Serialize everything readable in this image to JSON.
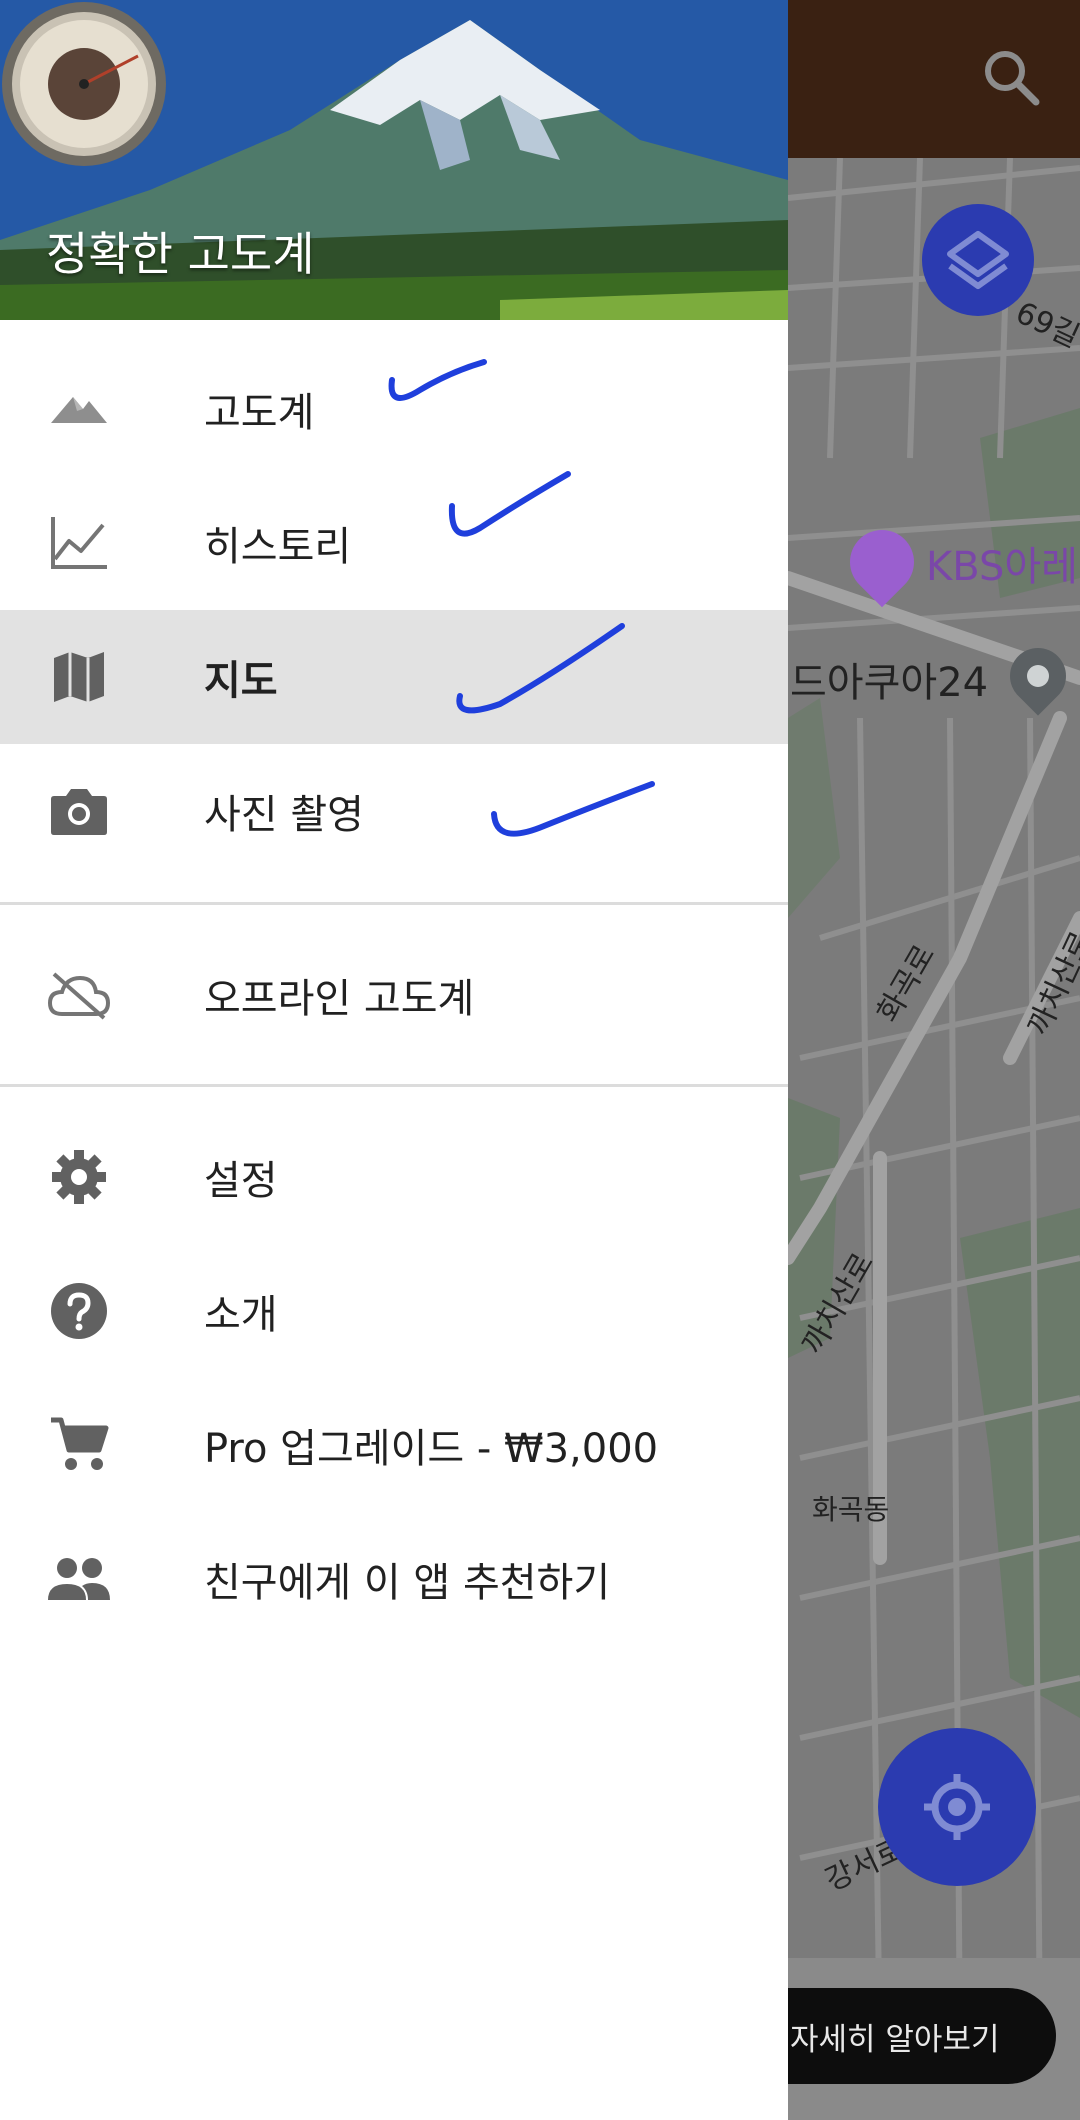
{
  "app": {
    "title": "정확한 고도계"
  },
  "map": {
    "poi_kbs": "KBS아레",
    "store": "드아쿠아24",
    "road1": "화곡로",
    "road2": "까치산로",
    "road3": "까치산로",
    "district": "화곡동",
    "road4": "강서로",
    "street_num": "69길",
    "learn_more": "자세히 알아보기"
  },
  "nav": {
    "items": [
      {
        "label": "고도계",
        "icon": "mountain-icon"
      },
      {
        "label": "히스토리",
        "icon": "chart-line-icon"
      },
      {
        "label": "지도",
        "icon": "map-icon",
        "selected": true
      },
      {
        "label": "사진 촬영",
        "icon": "camera-icon"
      }
    ],
    "offline": {
      "label": "오프라인 고도계",
      "icon": "cloud-off-icon"
    },
    "extras": [
      {
        "label": "설정",
        "icon": "gear-icon"
      },
      {
        "label": "소개",
        "icon": "help-icon"
      },
      {
        "label": "Pro 업그레이드 - ₩3,000",
        "icon": "cart-icon"
      },
      {
        "label": "친구에게 이 앱 추천하기",
        "icon": "people-icon"
      }
    ]
  },
  "colors": {
    "appbar": "#5a341d",
    "fab": "#2b3bb0",
    "check_marks": "#1f3fdc",
    "selected_row": "#e2e2e2"
  }
}
